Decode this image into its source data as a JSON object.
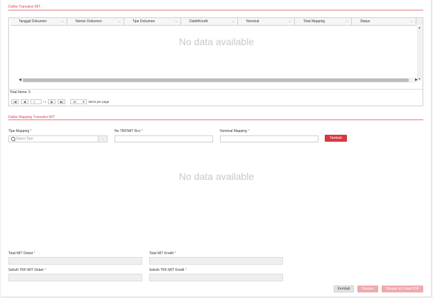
{
  "section1": {
    "title": "Daftar Transaksi MIT",
    "columns": [
      "Tanggal Dokumen",
      "Nomor Dokumen",
      "Tipe Dokumen",
      "Debit/Kredit",
      "Nominal",
      "Total Mapping",
      "Status"
    ],
    "empty_text": "No data available",
    "total_items_label": "Total Items: 0",
    "pager": {
      "page": "1",
      "of_label": "/ 1",
      "page_size": "50",
      "per_page_label": "items per page"
    }
  },
  "section2": {
    "title": "Daftar Mapping Transaksi MIT",
    "tipe_label": "Tipe Mapping",
    "tipe_placeholder": "Select Tipe",
    "no_trf_label": "No TRF/MIT Rcv",
    "nominal_label": "Nominal Mapping",
    "tambah_label": "Tambah",
    "empty_text": "No data available"
  },
  "totals": {
    "total_debet_label": "Total MIT Debet",
    "total_kredit_label": "Total MIT Kredit",
    "selisih_debet_label": "Selisih TRF-MIT Debet",
    "selisih_kredit_label": "Selisih TRF-MIT Kredit"
  },
  "actions": {
    "kembali_label": "Kembali",
    "simpan_label": "Simpan",
    "simpan_cetak_label": "Simpan & Cetak PDF"
  },
  "required_mark": "*",
  "icons": {
    "sort": "chevron-down-icon",
    "search": "search-icon"
  },
  "colors": {
    "accent": "#d7373f",
    "accent_light": "#f0a9ad",
    "title": "#e0454f"
  }
}
